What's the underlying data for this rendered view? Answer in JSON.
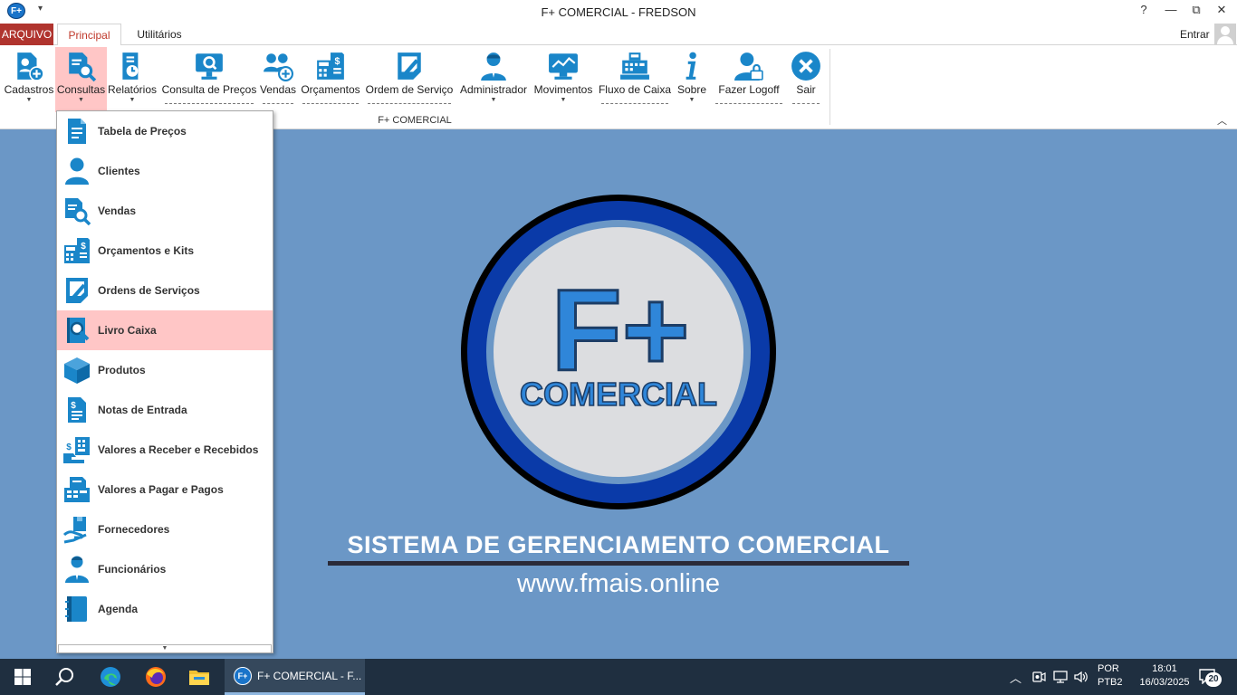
{
  "window": {
    "title": "F+ COMERCIAL - FREDSON",
    "app_icon_text": "F+",
    "help": "?",
    "minimize": "—",
    "restore": "⧉",
    "close": "✕"
  },
  "tabs": {
    "arquivo": "ARQUIVO",
    "principal": "Principal",
    "utilitarios": "Utilitários",
    "entrar": "Entrar"
  },
  "ribbon": {
    "group_label": "F+ COMERCIAL",
    "items": [
      {
        "label": "Cadastros",
        "icon": "user-add-document-icon"
      },
      {
        "label": "Consultas",
        "icon": "document-search-icon"
      },
      {
        "label": "Relatórios",
        "icon": "report-clock-icon"
      },
      {
        "label": "Consulta de Preços",
        "icon": "monitor-search-icon"
      },
      {
        "label": "Vendas",
        "icon": "group-add-icon"
      },
      {
        "label": "Orçamentos",
        "icon": "calculator-money-icon"
      },
      {
        "label": "Ordem de Serviço",
        "icon": "service-order-icon"
      },
      {
        "label": "Administrador",
        "icon": "administrator-icon"
      },
      {
        "label": "Movimentos",
        "icon": "chart-monitor-icon"
      },
      {
        "label": "Fluxo de Caixa",
        "icon": "cash-register-icon"
      },
      {
        "label": "Sobre",
        "icon": "info-icon"
      },
      {
        "label": "Fazer Logoff",
        "icon": "user-lock-icon"
      },
      {
        "label": "Sair",
        "icon": "close-circle-icon"
      }
    ]
  },
  "dropdown": {
    "items": [
      {
        "label": "Tabela de Preços",
        "icon": "price-list-icon"
      },
      {
        "label": "Clientes",
        "icon": "person-icon"
      },
      {
        "label": "Vendas",
        "icon": "document-search-icon"
      },
      {
        "label": "Orçamentos e Kits",
        "icon": "calculator-money-icon"
      },
      {
        "label": "Ordens de Serviços",
        "icon": "service-order-icon"
      },
      {
        "label": "Livro Caixa",
        "icon": "ledger-search-icon"
      },
      {
        "label": "Produtos",
        "icon": "box-icon"
      },
      {
        "label": "Notas de Entrada",
        "icon": "invoice-icon"
      },
      {
        "label": "Valores a Receber e Recebidos",
        "icon": "receivables-icon"
      },
      {
        "label": "Valores a Pagar e Pagos",
        "icon": "payables-icon"
      },
      {
        "label": "Fornecedores",
        "icon": "supplier-icon"
      },
      {
        "label": "Funcionários",
        "icon": "employee-icon"
      },
      {
        "label": "Agenda",
        "icon": "agenda-icon"
      }
    ],
    "active_label": "Livro Caixa"
  },
  "logo": {
    "big_text": "F+",
    "sub_text": "COMERCIAL"
  },
  "main": {
    "system_title": "SISTEMA DE GERENCIAMENTO COMERCIAL",
    "url": "www.fmais.online"
  },
  "taskbar": {
    "task_icon_text": "F+",
    "task_label": "F+ COMERCIAL - F...",
    "lang_line1": "POR",
    "lang_line2": "PTB2",
    "time": "18:01",
    "date": "16/03/2025",
    "notifications": "20"
  },
  "colors": {
    "accent_red": "#b0342e",
    "icon_blue": "#1a86c9",
    "background_blue": "#6b97c6",
    "active_highlight": "#ffc6c6"
  }
}
